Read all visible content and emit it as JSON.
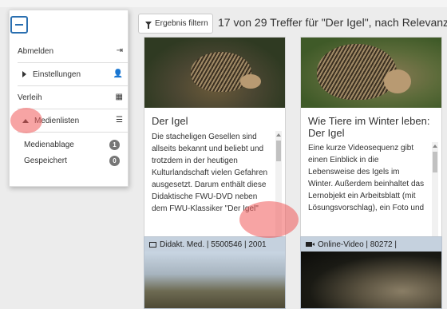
{
  "toolbar": {
    "filter_label": "Ergebnis filtern",
    "result_summary": "17 von 29 Treffer für \"Der Igel\", nach Relevanz"
  },
  "side_menu": {
    "items": [
      {
        "label": "Abmelden",
        "icon": "sign-in-icon"
      },
      {
        "label": "Einstellungen",
        "icon": "user-icon"
      },
      {
        "label": "Verleih",
        "icon": "calendar-icon"
      },
      {
        "label": "Medienlisten",
        "icon": "list-icon"
      }
    ],
    "sublists": [
      {
        "label": "Medienablage",
        "count": "1"
      },
      {
        "label": "Gespeichert",
        "count": "0"
      }
    ]
  },
  "cards": [
    {
      "title": "Der Igel",
      "description": "Die stacheligen Gesellen sind allseits bekannt und beliebt und trotzdem in der heutigen Kulturlandschaft vielen Gefahren ausgesetzt. Darum enthält diese Didaktische FWU-DVD neben dem FWU-Klassiker \"Der Igel\"",
      "actions": [
        "play-icon",
        "download-icon",
        "document-icon",
        "star-icon"
      ]
    },
    {
      "title": "Wie Tiere im Winter leben: Der Igel",
      "description": "Eine kurze Videosequenz gibt einen Einblick in die Lebensweise des Igels im Winter. Außerdem beinhaltet das Lernobjekt ein Arbeitsblatt (mit Lösungsvorschlag), ein Foto und",
      "actions": [
        "play-icon",
        "download-icon",
        "document-icon",
        "star-icon"
      ]
    }
  ],
  "lower_cards": [
    {
      "header": "Didakt. Med. | 5500546 | 2001",
      "icon": "monitor-icon"
    },
    {
      "header": "Online-Video | 80272 |",
      "icon": "video-camera-icon"
    }
  ],
  "colors": {
    "accent": "#2a6fb0",
    "highlight": "#f05a5a",
    "card_header": "#c5d1de"
  }
}
